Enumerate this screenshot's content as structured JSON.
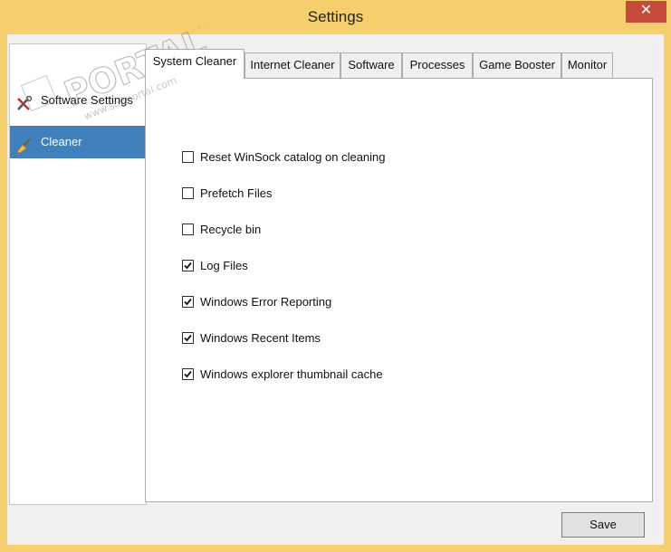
{
  "window": {
    "title": "Settings",
    "close_glyph": "✕",
    "accent_color": "#f4cf6b",
    "close_color": "#c74b3d"
  },
  "nav": {
    "items": [
      {
        "label": "Software Settings",
        "icon": "tools-icon",
        "selected": false
      },
      {
        "label": "Cleaner",
        "icon": "broom-icon",
        "selected": true
      }
    ],
    "selected_color": "#3f80bd"
  },
  "tabs": [
    {
      "label": "System Cleaner",
      "active": true
    },
    {
      "label": "Internet Cleaner",
      "active": false
    },
    {
      "label": "Software",
      "active": false
    },
    {
      "label": "Processes",
      "active": false
    },
    {
      "label": "Game Booster",
      "active": false
    },
    {
      "label": "Monitor",
      "active": false
    }
  ],
  "options": [
    {
      "label": "Reset WinSock catalog on cleaning",
      "checked": false
    },
    {
      "label": "Prefetch Files",
      "checked": false
    },
    {
      "label": "Recycle bin",
      "checked": false
    },
    {
      "label": "Log Files",
      "checked": true
    },
    {
      "label": "Windows Error Reporting",
      "checked": true
    },
    {
      "label": "Windows Recent Items",
      "checked": true
    },
    {
      "label": "Windows explorer thumbnail cache",
      "checked": true
    }
  ],
  "footer": {
    "save_label": "Save"
  },
  "watermark": {
    "brand": "PORTAL",
    "site": "www.softportal.com",
    "tm": "TM"
  }
}
